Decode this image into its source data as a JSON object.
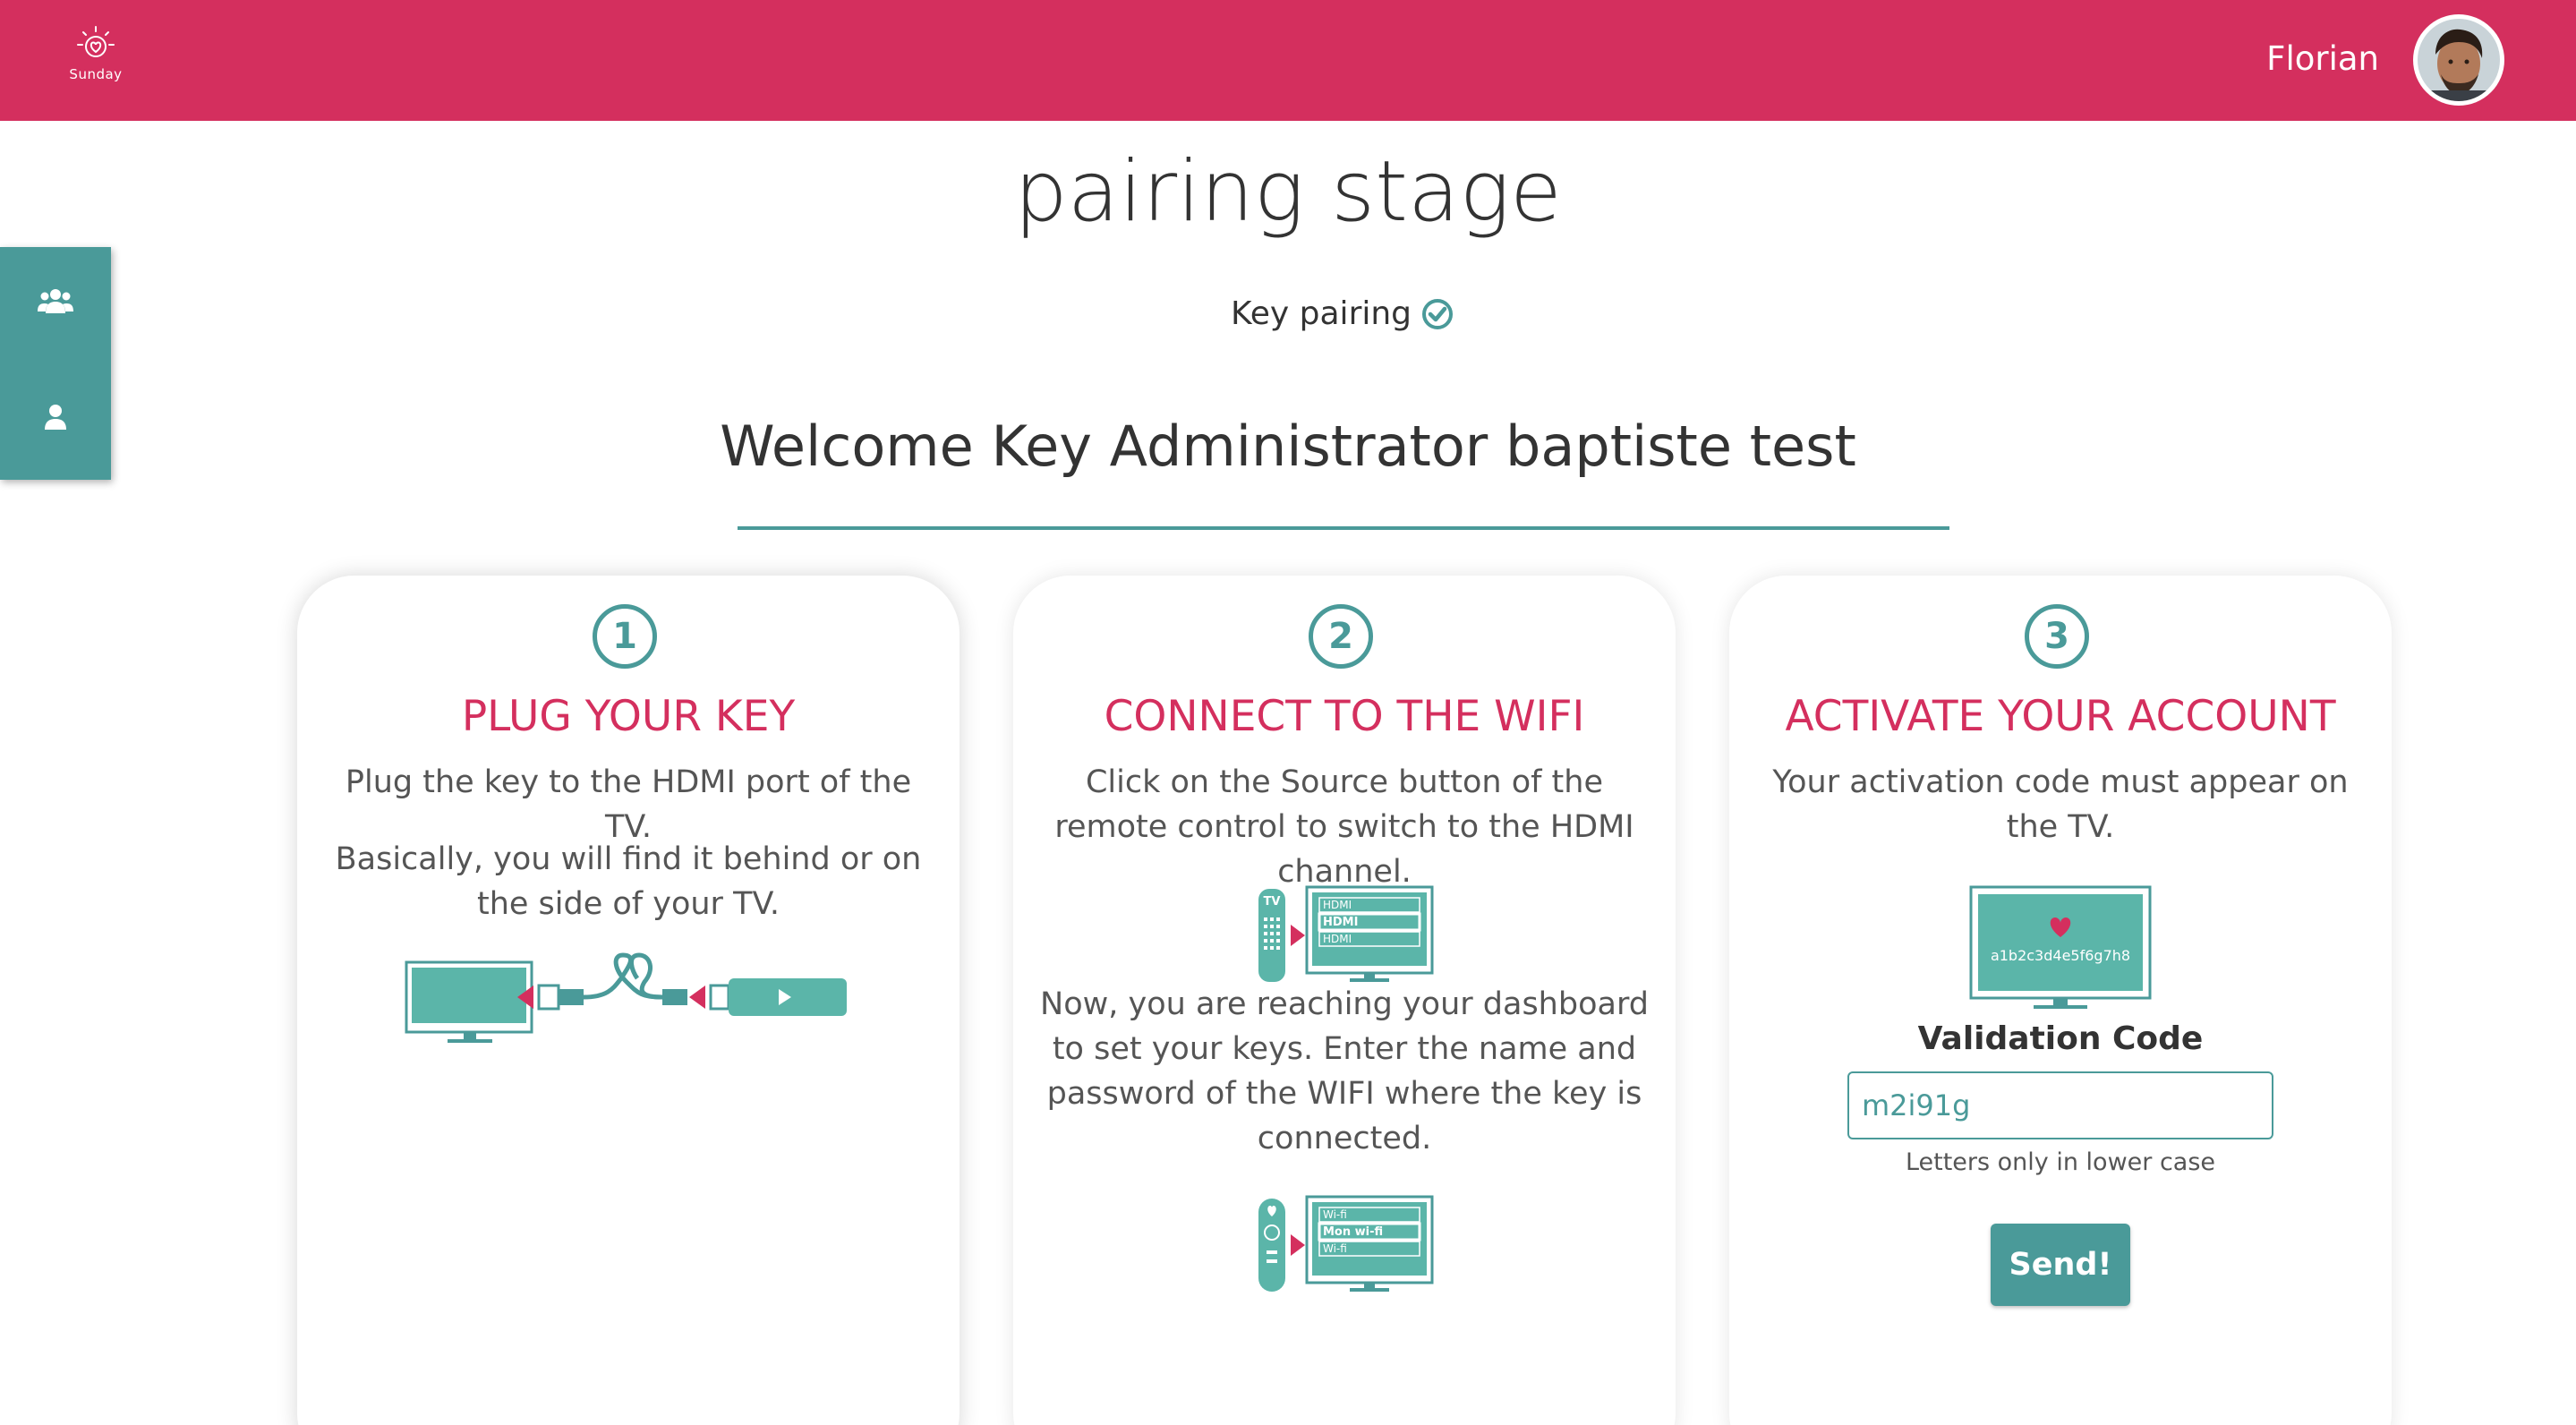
{
  "header": {
    "logo_text": "Sunday",
    "user_name": "Florian",
    "background": "#d42f5e"
  },
  "sidebar": {
    "items": [
      {
        "icon": "users-icon"
      },
      {
        "icon": "user-icon"
      }
    ],
    "background": "#4a9a99"
  },
  "main": {
    "title": "pairing stage",
    "pairing_status": "Key pairing",
    "welcome": "Welcome Key Administrator baptiste test",
    "accent": "#4a9a99",
    "steps": [
      {
        "number": "1",
        "title": "PLUG YOUR KEY",
        "text1": "Plug the key to the HDMI port of the TV.",
        "text2": "Basically, you will find it behind or on the side of your TV."
      },
      {
        "number": "2",
        "title": "CONNECT TO THE WIFI",
        "text1": "Click on the Source button of the remote control to switch to the HDMI channel.",
        "text2": "Now, you are reaching your dashboard to set your keys. Enter the name and password of the WIFI where the key is connected.",
        "remote1_label": "TV",
        "menu1": [
          "HDMI",
          "HDMI",
          "HDMI"
        ],
        "menu2": [
          "Wi-fi",
          "Mon wi-fi",
          "Wi-fi"
        ]
      },
      {
        "number": "3",
        "title": "ACTIVATE YOUR ACCOUNT",
        "text1": "Your activation code must appear on the TV.",
        "tv_code": "a1b2c3d4e5f6g7h8",
        "validation_label": "Validation Code",
        "code_value": "m2i91g",
        "hint": "Letters only in lower case",
        "send_label": "Send!"
      }
    ]
  }
}
